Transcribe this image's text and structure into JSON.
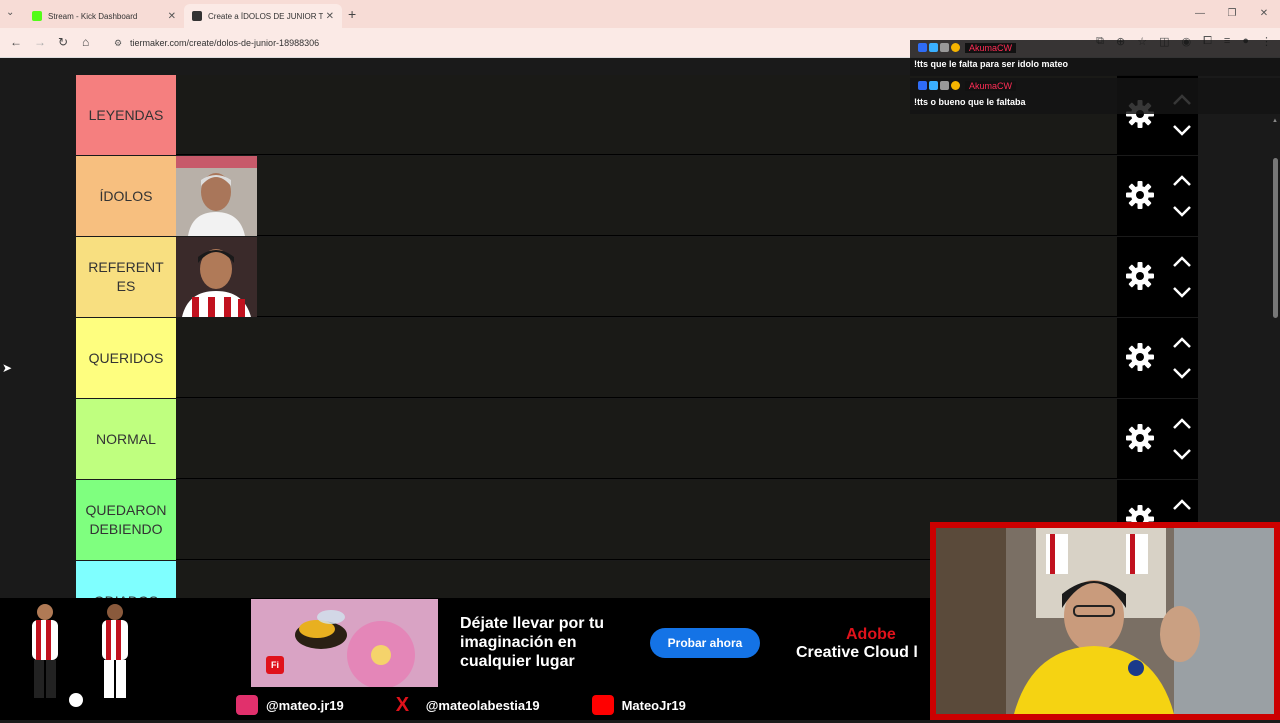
{
  "browser": {
    "tabs": [
      {
        "title": "Stream - Kick Dashboard",
        "favicon_color": "#53fc18"
      },
      {
        "title": "Create a ÍDOLOS DE JUNIOR Ti",
        "favicon_color": "#333333"
      }
    ],
    "url": "tiermaker.com/create/dolos-de-junior-18988306"
  },
  "tiers": [
    {
      "label": "LEYENDAS",
      "color": "#f57f7f",
      "images": []
    },
    {
      "label": "ÍDOLOS",
      "color": "#f7bf7f",
      "images": [
        "player-portrait-1"
      ]
    },
    {
      "label": "REFERENT ES",
      "color": "#f8df80",
      "images": [
        "player-portrait-2"
      ]
    },
    {
      "label": "QUERIDOS",
      "color": "#fefe7f",
      "images": []
    },
    {
      "label": "NORMAL",
      "color": "#bfff7f",
      "images": []
    },
    {
      "label": "QUEDARON DEBIENDO",
      "color": "#7fff7f",
      "images": []
    },
    {
      "label": "ODIADOS",
      "color": "#7fffff",
      "images": []
    }
  ],
  "chat": [
    {
      "user": "AkumaCW",
      "message": "!tts que le falta para ser idolo mateo"
    },
    {
      "user": "AkumaCW",
      "message": "!tts o bueno que le faltaba"
    }
  ],
  "ad": {
    "headline": "Déjate llevar por tu imaginación en cualquier lugar",
    "button": "Probar ahora",
    "brand_line1": "Adobe",
    "brand_line2": "Creative Cloud l",
    "fi_badge": "Fi"
  },
  "socials": [
    {
      "handle": "@mateo.jr19",
      "icon": "instagram-icon",
      "color": "#e1306c"
    },
    {
      "handle": "@mateolabestia19",
      "icon": "x-icon",
      "color": "#e0121b"
    },
    {
      "handle": "MateoJr19",
      "icon": "youtube-icon",
      "color": "#ff0000"
    }
  ]
}
